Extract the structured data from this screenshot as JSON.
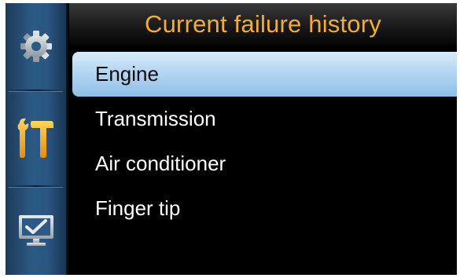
{
  "header": {
    "title": "Current failure history"
  },
  "sidebar": {
    "items": [
      {
        "icon": "gear-icon",
        "active": false,
        "color": "#bfc6cf"
      },
      {
        "icon": "tools-icon",
        "active": true,
        "color": "#f5a623"
      },
      {
        "icon": "monitor-check-icon",
        "active": false,
        "color": "#bfc6cf"
      }
    ]
  },
  "menu": {
    "selected_index": 0,
    "items": [
      {
        "label": "Engine"
      },
      {
        "label": "Transmission"
      },
      {
        "label": "Air conditioner"
      },
      {
        "label": "Finger tip"
      }
    ]
  },
  "colors": {
    "title_accent": "#f3ad36",
    "selection": "#b4d6f2",
    "sidebar": "#2c5a86",
    "background": "#000000"
  }
}
